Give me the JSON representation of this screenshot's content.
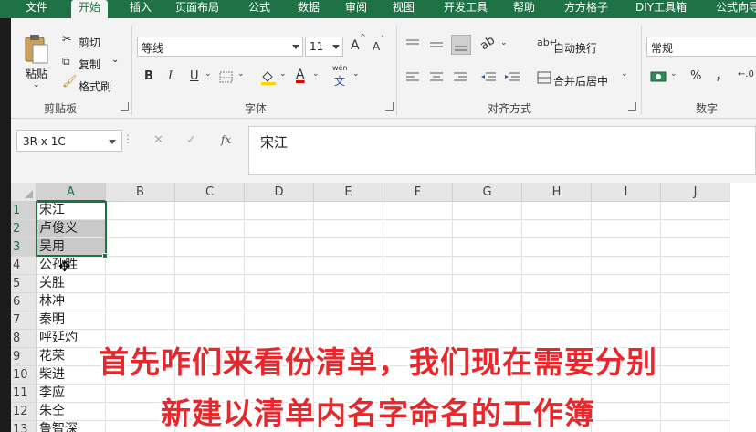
{
  "tabs": [
    "文件",
    "开始",
    "插入",
    "页面布局",
    "公式",
    "数据",
    "审阅",
    "视图",
    "开发工具",
    "帮助",
    "方方格子",
    "DIY工具箱",
    "公式向导"
  ],
  "active_tab_index": 1,
  "clipboard": {
    "paste_label": "粘贴",
    "cut_label": "剪切",
    "copy_label": "复制",
    "format_painter_label": "格式刷",
    "group_label": "剪贴板"
  },
  "font": {
    "font_name": "等线",
    "font_size": "11",
    "grow_label": "A",
    "shrink_label": "A",
    "bold_label": "B",
    "italic_label": "I",
    "underline_label": "U",
    "font_color_label": "A",
    "wen_label": "wén",
    "wen_char": "文",
    "group_label": "字体"
  },
  "alignment": {
    "wrap_label": "自动换行",
    "merge_label": "合并后居中",
    "group_label": "对齐方式"
  },
  "number": {
    "format": "常规",
    "percent_label": "%",
    "comma_label": "，",
    "decimal_label": "←.0",
    "group_label": "数字"
  },
  "formula_bar": {
    "name_box": "3R x 1C",
    "cancel_symbol": "✕",
    "enter_symbol": "✓",
    "fx_label": "fx",
    "content": "宋江"
  },
  "grid": {
    "columns": [
      "A",
      "B",
      "C",
      "D",
      "E",
      "F",
      "G",
      "H",
      "I",
      "J"
    ],
    "rows": [
      {
        "n": "1",
        "a": "宋江"
      },
      {
        "n": "2",
        "a": "卢俊义"
      },
      {
        "n": "3",
        "a": "吴用"
      },
      {
        "n": "4",
        "a": "公孙胜"
      },
      {
        "n": "5",
        "a": "关胜"
      },
      {
        "n": "6",
        "a": "林冲"
      },
      {
        "n": "7",
        "a": "秦明"
      },
      {
        "n": "8",
        "a": "呼延灼"
      },
      {
        "n": "9",
        "a": "花荣"
      },
      {
        "n": "10",
        "a": "柴进"
      },
      {
        "n": "11",
        "a": "李应"
      },
      {
        "n": "12",
        "a": "朱仝"
      },
      {
        "n": "13",
        "a": "鲁智深"
      }
    ],
    "selected_rows": 3
  },
  "subtitle": {
    "line1": "首先咋们来看份清单，我们现在需要分别",
    "line2": "新建以清单内名字命名的工作簿",
    "color": "#e8262b"
  },
  "colors": {
    "accent": "#1f7246"
  }
}
